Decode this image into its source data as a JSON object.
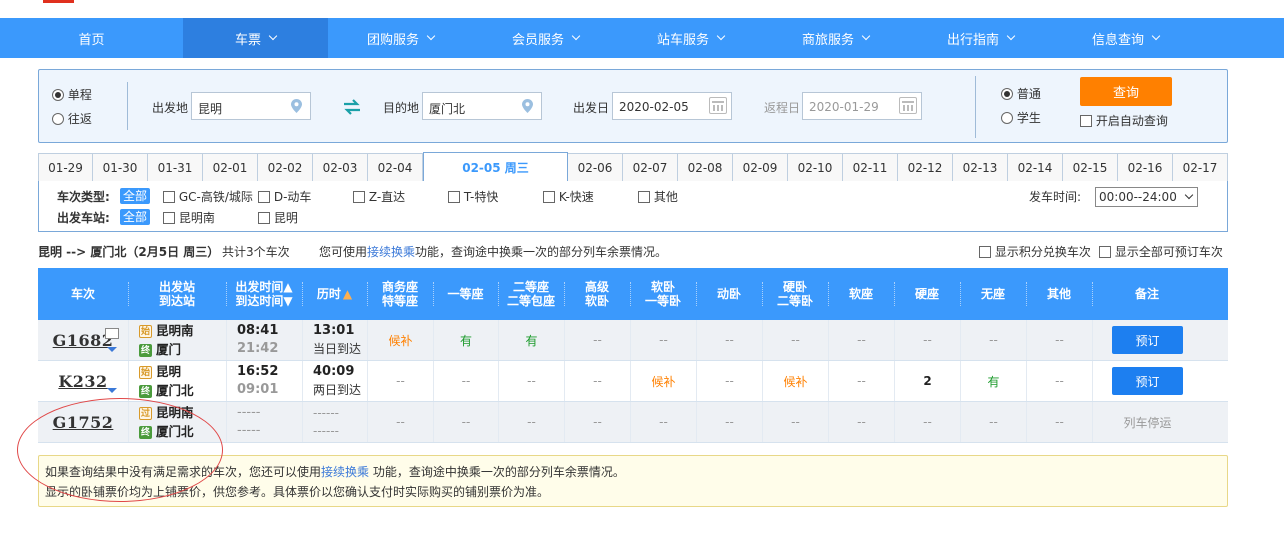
{
  "nav": {
    "items": [
      "首页",
      "车票",
      "团购服务",
      "会员服务",
      "站车服务",
      "商旅服务",
      "出行指南",
      "信息查询"
    ]
  },
  "search": {
    "trip_oneway": "单程",
    "trip_round": "往返",
    "from_label": "出发地",
    "from_value": "昆明",
    "to_label": "目的地",
    "to_value": "厦门北",
    "depart_label": "出发日",
    "depart_value": "2020-02-05",
    "return_label": "返程日",
    "return_value": "2020-01-29",
    "type_normal": "普通",
    "type_student": "学生",
    "query_button": "查询",
    "auto_query": "开启自动查询"
  },
  "dates": [
    "01-29",
    "01-30",
    "01-31",
    "02-01",
    "02-02",
    "02-03",
    "02-04",
    "02-05 周三",
    "02-06",
    "02-07",
    "02-08",
    "02-09",
    "02-10",
    "02-11",
    "02-12",
    "02-13",
    "02-14",
    "02-15",
    "02-16",
    "02-17"
  ],
  "filter": {
    "type_label": "车次类型:",
    "all": "全部",
    "types": [
      "GC-高铁/城际",
      "D-动车",
      "Z-直达",
      "T-特快",
      "K-快速",
      "其他"
    ],
    "station_label": "出发车站:",
    "stations": [
      "昆明南",
      "昆明"
    ],
    "time_label": "发车时间:",
    "time_value": "00:00--24:00"
  },
  "summary": {
    "route": "昆明 --> 厦门北（2月5日  周三）",
    "count": "共计3个车次",
    "tip_pre": "您可使用",
    "tip_link": "接续换乘",
    "tip_post": "功能，查询途中换乘一次的部分列车余票情况。",
    "opt_points": "显示积分兑换车次",
    "opt_all": "显示全部可预订车次"
  },
  "table": {
    "headers": [
      "车次",
      "出发站\n到达站",
      "出发时间▲\n到达时间▼",
      "历时",
      "商务座\n特等座",
      "一等座",
      "二等座\n二等包座",
      "高级\n软卧",
      "软卧\n一等卧",
      "动卧",
      "硬卧\n二等卧",
      "软座",
      "硬座",
      "无座",
      "其他",
      "备注"
    ],
    "rows": [
      {
        "no": "G1682",
        "from": "昆明南",
        "to": "厦门",
        "dep": "08:41",
        "arr": "21:42",
        "dur": "13:01",
        "dur_note": "当日到达",
        "seats": [
          "候补",
          "有",
          "有",
          "--",
          "--",
          "--",
          "--",
          "--",
          "--",
          "--",
          "--"
        ],
        "action": "预订"
      },
      {
        "no": "K232",
        "from": "昆明",
        "to": "厦门北",
        "dep": "16:52",
        "arr": "09:01",
        "dur": "40:09",
        "dur_note": "两日到达",
        "seats": [
          "--",
          "--",
          "--",
          "--",
          "候补",
          "--",
          "候补",
          "--",
          "2",
          "有",
          "--"
        ],
        "action": "预订"
      },
      {
        "no": "G1752",
        "from": "昆明南",
        "to": "厦门北",
        "dep": "-----",
        "arr": "-----",
        "dur": "------",
        "dur_note": "------",
        "seats": [
          "--",
          "--",
          "--",
          "--",
          "--",
          "--",
          "--",
          "--",
          "--",
          "--",
          "--"
        ],
        "action": "列车停运"
      }
    ],
    "badge_start": "始",
    "badge_end": "终",
    "badge_pass": "过"
  },
  "notice": {
    "line1_pre": "如果查询结果中没有满足需求的车次，您还可以使用",
    "line1_link": "接续换乘",
    "line1_post": " 功能，查询途中换乘一次的部分列车余票情况。",
    "line2": "显示的卧铺票价均为上铺票价，供您参考。具体票价以您确认支付时实际购买的铺别票价为准。"
  },
  "colors": {
    "nav": "#3b99fc",
    "nav_active": "#2d7fe0",
    "query": "#ff8000",
    "book": "#1d7ff0",
    "available": "#1a9a2a",
    "waitlist": "#ff8000"
  }
}
